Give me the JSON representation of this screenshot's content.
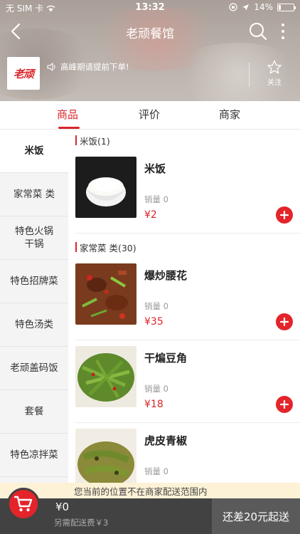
{
  "status_bar": {
    "carrier": "无 SIM 卡",
    "time": "13:32",
    "battery": "14%",
    "battery_level": 0.14
  },
  "nav": {
    "title": "老顽餐馆"
  },
  "shop": {
    "logo_text": "老顽",
    "notice": "高峰期请提前下单!",
    "follow_label": "关注"
  },
  "tabs": [
    {
      "label": "商品",
      "active": true
    },
    {
      "label": "评价",
      "active": false
    },
    {
      "label": "商家",
      "active": false
    }
  ],
  "sidebar": {
    "items": [
      {
        "label": "米饭",
        "active": true
      },
      {
        "label": "家常菜 类",
        "active": false
      },
      {
        "label": "特色火锅\n干锅",
        "active": false
      },
      {
        "label": "特色招牌菜",
        "active": false
      },
      {
        "label": "特色汤类",
        "active": false
      },
      {
        "label": "老顽盖码饭",
        "active": false
      },
      {
        "label": "套餐",
        "active": false
      },
      {
        "label": "特色凉拌菜",
        "active": false
      }
    ]
  },
  "sections": [
    {
      "title": "米饭(1)",
      "dishes": [
        {
          "name": "米饭",
          "sales": "销量 0",
          "price": "¥2",
          "photo": "rice"
        }
      ]
    },
    {
      "title": "家常菜 类(30)",
      "dishes": [
        {
          "name": "爆炒腰花",
          "sales": "销量 0",
          "price": "¥35",
          "photo": "kidney"
        },
        {
          "name": "干煸豆角",
          "sales": "销量 0",
          "price": "¥18",
          "photo": "beans"
        },
        {
          "name": "虎皮青椒",
          "sales": "销量 0",
          "price": "",
          "photo": "pepper"
        }
      ]
    }
  ],
  "warning": "您当前的位置不在商家配送范围内",
  "cart": {
    "total": "¥0",
    "delivery_fee": "另需配送费￥3",
    "checkout_label": "还差20元起送"
  },
  "colors": {
    "accent": "#d8262a",
    "cart_bar": "#424242",
    "warning_bg": "#fdf2d6"
  }
}
